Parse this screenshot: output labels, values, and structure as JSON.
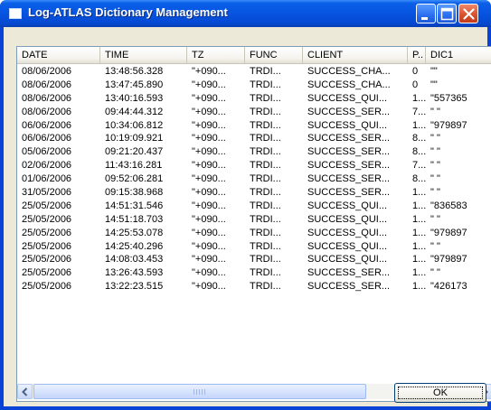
{
  "window": {
    "title": "Log-ATLAS Dictionary Management"
  },
  "list": {
    "columns": [
      "DATE",
      "TIME",
      "TZ",
      "FUNC",
      "CLIENT",
      "P..",
      "DIC1"
    ],
    "rows": [
      [
        "08/06/2006",
        "13:48:56.328",
        "\"+090...",
        "TRDI...",
        "SUCCESS_CHA...",
        "0",
        "\"\""
      ],
      [
        "08/06/2006",
        "13:47:45.890",
        "\"+090...",
        "TRDI...",
        "SUCCESS_CHA...",
        "0",
        "\"\""
      ],
      [
        "08/06/2006",
        "13:40:16.593",
        "\"+090...",
        "TRDI...",
        "SUCCESS_QUI...",
        "1...",
        "\"557365"
      ],
      [
        "08/06/2006",
        "09:44:44.312",
        "\"+090...",
        "TRDI...",
        "SUCCESS_SER...",
        "7...",
        "\" \""
      ],
      [
        "06/06/2006",
        "10:34:06.812",
        "\"+090...",
        "TRDI...",
        "SUCCESS_QUI...",
        "1...",
        "\"979897"
      ],
      [
        "06/06/2006",
        "10:19:09.921",
        "\"+090...",
        "TRDI...",
        "SUCCESS_SER...",
        "8...",
        "\" \""
      ],
      [
        "05/06/2006",
        "09:21:20.437",
        "\"+090...",
        "TRDI...",
        "SUCCESS_SER...",
        "8...",
        "\" \""
      ],
      [
        "02/06/2006",
        "11:43:16.281",
        "\"+090...",
        "TRDI...",
        "SUCCESS_SER...",
        "7...",
        "\" \""
      ],
      [
        "01/06/2006",
        "09:52:06.281",
        "\"+090...",
        "TRDI...",
        "SUCCESS_SER...",
        "8...",
        "\" \""
      ],
      [
        "31/05/2006",
        "09:15:38.968",
        "\"+090...",
        "TRDI...",
        "SUCCESS_SER...",
        "1...",
        "\" \""
      ],
      [
        "25/05/2006",
        "14:51:31.546",
        "\"+090...",
        "TRDI...",
        "SUCCESS_QUI...",
        "1...",
        "\"836583"
      ],
      [
        "25/05/2006",
        "14:51:18.703",
        "\"+090...",
        "TRDI...",
        "SUCCESS_QUI...",
        "1...",
        "\" \""
      ],
      [
        "25/05/2006",
        "14:25:53.078",
        "\"+090...",
        "TRDI...",
        "SUCCESS_QUI...",
        "1...",
        "\"979897"
      ],
      [
        "25/05/2006",
        "14:25:40.296",
        "\"+090...",
        "TRDI...",
        "SUCCESS_QUI...",
        "1...",
        "\" \""
      ],
      [
        "25/05/2006",
        "14:08:03.453",
        "\"+090...",
        "TRDI...",
        "SUCCESS_QUI...",
        "1...",
        "\"979897"
      ],
      [
        "25/05/2006",
        "13:26:43.593",
        "\"+090...",
        "TRDI...",
        "SUCCESS_SER...",
        "1...",
        "\" \""
      ],
      [
        "25/05/2006",
        "13:22:23.515",
        "\"+090...",
        "TRDI...",
        "SUCCESS_SER...",
        "1...",
        "\"426173"
      ]
    ]
  },
  "buttons": {
    "ok_label": "OK"
  },
  "icons": {
    "app": "window-app-icon",
    "minimize": "minimize-icon",
    "maximize": "maximize-icon",
    "close": "close-icon",
    "scroll_left": "scroll-left-arrow-icon",
    "scroll_right": "scroll-right-arrow-icon"
  },
  "colors": {
    "titlebar": "#0754e0",
    "close_button": "#d9532e",
    "dialog_face": "#ece9d8"
  }
}
